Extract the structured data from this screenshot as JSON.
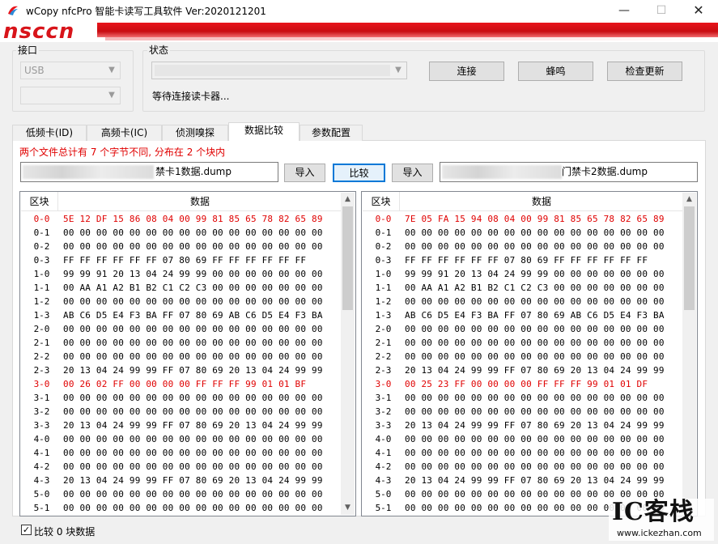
{
  "window": {
    "title": "wCopy nfcPro 智能卡读写工具软件  Ver:2020121201",
    "minimize_glyph": "—",
    "maximize_glyph": "☐",
    "close_glyph": "✕"
  },
  "banner": {
    "logo_text": "nsccn",
    "accent_color": "#d8141a"
  },
  "port_group": {
    "label": "接口",
    "interface_value": "USB",
    "second_value": ""
  },
  "status_group": {
    "label": "状态",
    "status_text": "等待连接读卡器...",
    "buttons": {
      "connect": "连接",
      "beep": "蜂鸣",
      "update": "检查更新"
    }
  },
  "tabs": [
    {
      "label": "低频卡(ID)"
    },
    {
      "label": "高频卡(IC)"
    },
    {
      "label": "侦测嗅探"
    },
    {
      "label": "数据比较"
    },
    {
      "label": "参数配置"
    }
  ],
  "compare": {
    "summary": "两个文件总计有 7 个字节不同, 分布在 2 个块内",
    "file1_name": "禁卡1数据.dump",
    "file2_name": "门禁卡2数据.dump",
    "import_label": "导入",
    "compare_label": "比较",
    "diff_color": "#e00000",
    "checkbox_label": "比较 0 块数据",
    "checkbox_mark": "✓"
  },
  "left_table": {
    "col_block": "区块",
    "col_data": "数据",
    "rows": [
      {
        "block": "0-0",
        "data": "5E 12 DF 15 86 08 04 00 99 81 85 65 78 82 65 89",
        "diff": true
      },
      {
        "block": "0-1",
        "data": "00 00 00 00 00 00 00 00 00 00 00 00 00 00 00 00",
        "diff": false
      },
      {
        "block": "0-2",
        "data": "00 00 00 00 00 00 00 00 00 00 00 00 00 00 00 00",
        "diff": false
      },
      {
        "block": "0-3",
        "data": "FF FF FF FF FF FF 07 80 69 FF FF FF FF FF FF",
        "diff": false
      },
      {
        "block": "1-0",
        "data": "99 99 91 20 13 04 24 99 99 00 00 00 00 00 00 00",
        "diff": false
      },
      {
        "block": "1-1",
        "data": "00 AA A1 A2 B1 B2 C1 C2 C3 00 00 00 00 00 00 00",
        "diff": false
      },
      {
        "block": "1-2",
        "data": "00 00 00 00 00 00 00 00 00 00 00 00 00 00 00 00",
        "diff": false
      },
      {
        "block": "1-3",
        "data": "AB C6 D5 E4 F3 BA FF 07 80 69 AB C6 D5 E4 F3 BA",
        "diff": false
      },
      {
        "block": "2-0",
        "data": "00 00 00 00 00 00 00 00 00 00 00 00 00 00 00 00",
        "diff": false
      },
      {
        "block": "2-1",
        "data": "00 00 00 00 00 00 00 00 00 00 00 00 00 00 00 00",
        "diff": false
      },
      {
        "block": "2-2",
        "data": "00 00 00 00 00 00 00 00 00 00 00 00 00 00 00 00",
        "diff": false
      },
      {
        "block": "2-3",
        "data": "20 13 04 24 99 99 FF 07 80 69 20 13 04 24 99 99",
        "diff": false
      },
      {
        "block": "3-0",
        "data": "00 26 02 FF 00 00 00 00 FF FF FF 99 01 01 BF",
        "diff": true
      },
      {
        "block": "3-1",
        "data": "00 00 00 00 00 00 00 00 00 00 00 00 00 00 00 00",
        "diff": false
      },
      {
        "block": "3-2",
        "data": "00 00 00 00 00 00 00 00 00 00 00 00 00 00 00 00",
        "diff": false
      },
      {
        "block": "3-3",
        "data": "20 13 04 24 99 99 FF 07 80 69 20 13 04 24 99 99",
        "diff": false
      },
      {
        "block": "4-0",
        "data": "00 00 00 00 00 00 00 00 00 00 00 00 00 00 00 00",
        "diff": false
      },
      {
        "block": "4-1",
        "data": "00 00 00 00 00 00 00 00 00 00 00 00 00 00 00 00",
        "diff": false
      },
      {
        "block": "4-2",
        "data": "00 00 00 00 00 00 00 00 00 00 00 00 00 00 00 00",
        "diff": false
      },
      {
        "block": "4-3",
        "data": "20 13 04 24 99 99 FF 07 80 69 20 13 04 24 99 99",
        "diff": false
      },
      {
        "block": "5-0",
        "data": "00 00 00 00 00 00 00 00 00 00 00 00 00 00 00 00",
        "diff": false
      },
      {
        "block": "5-1",
        "data": "00 00 00 00 00 00 00 00 00 00 00 00 00 00 00 00",
        "diff": false
      }
    ]
  },
  "right_table": {
    "col_block": "区块",
    "col_data": "数据",
    "rows": [
      {
        "block": "0-0",
        "data": "7E 05 FA 15 94 08 04 00 99 81 85 65 78 82 65 89",
        "diff": true
      },
      {
        "block": "0-1",
        "data": "00 00 00 00 00 00 00 00 00 00 00 00 00 00 00 00",
        "diff": false
      },
      {
        "block": "0-2",
        "data": "00 00 00 00 00 00 00 00 00 00 00 00 00 00 00 00",
        "diff": false
      },
      {
        "block": "0-3",
        "data": "FF FF FF FF FF FF 07 80 69 FF FF FF FF FF FF",
        "diff": false
      },
      {
        "block": "1-0",
        "data": "99 99 91 20 13 04 24 99 99 00 00 00 00 00 00 00",
        "diff": false
      },
      {
        "block": "1-1",
        "data": "00 AA A1 A2 B1 B2 C1 C2 C3 00 00 00 00 00 00 00",
        "diff": false
      },
      {
        "block": "1-2",
        "data": "00 00 00 00 00 00 00 00 00 00 00 00 00 00 00 00",
        "diff": false
      },
      {
        "block": "1-3",
        "data": "AB C6 D5 E4 F3 BA FF 07 80 69 AB C6 D5 E4 F3 BA",
        "diff": false
      },
      {
        "block": "2-0",
        "data": "00 00 00 00 00 00 00 00 00 00 00 00 00 00 00 00",
        "diff": false
      },
      {
        "block": "2-1",
        "data": "00 00 00 00 00 00 00 00 00 00 00 00 00 00 00 00",
        "diff": false
      },
      {
        "block": "2-2",
        "data": "00 00 00 00 00 00 00 00 00 00 00 00 00 00 00 00",
        "diff": false
      },
      {
        "block": "2-3",
        "data": "20 13 04 24 99 99 FF 07 80 69 20 13 04 24 99 99",
        "diff": false
      },
      {
        "block": "3-0",
        "data": "00 25 23 FF 00 00 00 00 FF FF FF 99 01 01 DF",
        "diff": true
      },
      {
        "block": "3-1",
        "data": "00 00 00 00 00 00 00 00 00 00 00 00 00 00 00 00",
        "diff": false
      },
      {
        "block": "3-2",
        "data": "00 00 00 00 00 00 00 00 00 00 00 00 00 00 00 00",
        "diff": false
      },
      {
        "block": "3-3",
        "data": "20 13 04 24 99 99 FF 07 80 69 20 13 04 24 99 99",
        "diff": false
      },
      {
        "block": "4-0",
        "data": "00 00 00 00 00 00 00 00 00 00 00 00 00 00 00 00",
        "diff": false
      },
      {
        "block": "4-1",
        "data": "00 00 00 00 00 00 00 00 00 00 00 00 00 00 00 00",
        "diff": false
      },
      {
        "block": "4-2",
        "data": "00 00 00 00 00 00 00 00 00 00 00 00 00 00 00 00",
        "diff": false
      },
      {
        "block": "4-3",
        "data": "20 13 04 24 99 99 FF 07 80 69 20 13 04 24 99 99",
        "diff": false
      },
      {
        "block": "5-0",
        "data": "00 00 00 00 00 00 00 00 00 00 00 00 00 00 00 00",
        "diff": false
      },
      {
        "block": "5-1",
        "data": "00 00 00 00 00 00 00 00 00 00 00 00 00 00 00 00",
        "diff": false
      }
    ]
  },
  "watermark": {
    "logo_text": "IC客栈",
    "url": "www.ickezhan.com"
  }
}
